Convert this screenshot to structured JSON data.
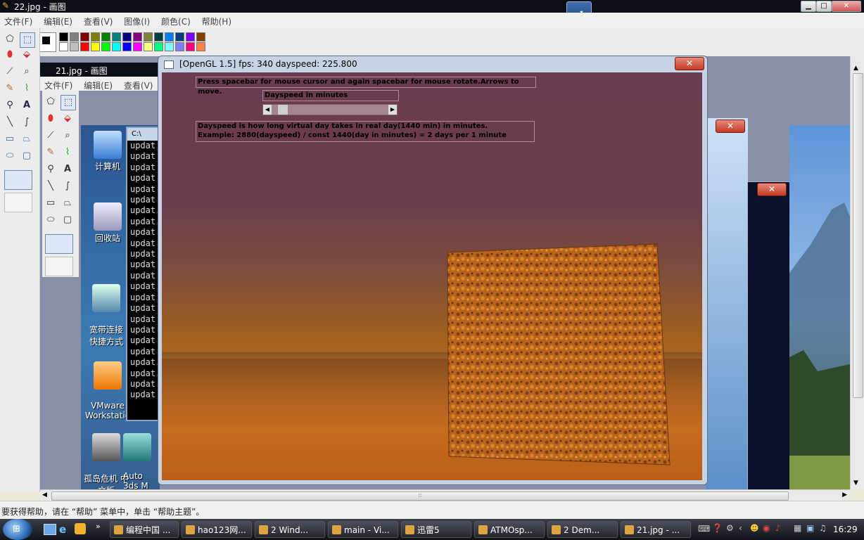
{
  "main_window": {
    "title": "22.jpg - 画图",
    "menus": [
      "文件(F)",
      "编辑(E)",
      "查看(V)",
      "图像(I)",
      "颜色(C)",
      "帮助(H)"
    ],
    "controls": [
      "▁",
      "□",
      "✕"
    ],
    "status_text": "要获得帮助，请在 “帮助” 菜单中，单击 “帮助主题”。"
  },
  "palette": {
    "row1": [
      "#000000",
      "#808080",
      "#800000",
      "#808000",
      "#008000",
      "#008080",
      "#000080",
      "#800080",
      "#808040",
      "#004040",
      "#0080ff",
      "#004080",
      "#8000ff",
      "#804000"
    ],
    "row2": [
      "#ffffff",
      "#c0c0c0",
      "#ff0000",
      "#ffff00",
      "#00ff00",
      "#00ffff",
      "#0000ff",
      "#ff00ff",
      "#ffff80",
      "#00ff80",
      "#80ffff",
      "#8080ff",
      "#ff0080",
      "#ff8040"
    ]
  },
  "inner_window": {
    "title": "21.jpg - 画图",
    "menus": [
      "文件(F)",
      "编辑(E)",
      "查看(V)"
    ]
  },
  "desktop_icons": [
    {
      "label": "计算机"
    },
    {
      "label": "回收站"
    },
    {
      "label": "宽带连接\n快捷方式"
    },
    {
      "label": "VMware\nWorkstatio"
    },
    {
      "label": "孤岛危机 中\n文版"
    },
    {
      "label": "Auto\n3ds M"
    }
  ],
  "console": {
    "title": "C:\\",
    "lines": [
      "updat",
      "updat",
      "updat",
      "updat",
      "updat",
      "updat",
      "updat",
      "updat",
      "updat",
      "updat",
      "updat",
      "updat",
      "updat",
      "updat",
      "updat",
      "updat",
      "updat",
      "updat",
      "updat",
      "updat",
      "updat",
      "updat",
      "updat",
      "updat"
    ]
  },
  "opengl_window": {
    "title": "[OpenGL 1.5] fps: 340 dayspeed: 225.800",
    "close_label": "✕",
    "help_line": "Press spacebar for mouse cursor and again spacebar for mouse rotate.Arrows to move.",
    "slider_label": "Dayspeed in minutes",
    "slider_value": 0.05,
    "info_line1": "Dayspeed is how long virtual day takes in real day(1440 min) in minutes.",
    "info_line2": "Example: 2880(dayspeed) / const 1440(day in minutes) = 2 days per 1 minute"
  },
  "taskbar": {
    "items": [
      "编程中国 ...",
      "hao123网...",
      "2 Wind...",
      "main - Vi...",
      "迅雷5",
      "ATMOsp...",
      "2 Dem...",
      "21.jpg - ..."
    ],
    "clock": "16:29"
  },
  "scroll": {
    "grip": "⦙⦙⦙"
  }
}
